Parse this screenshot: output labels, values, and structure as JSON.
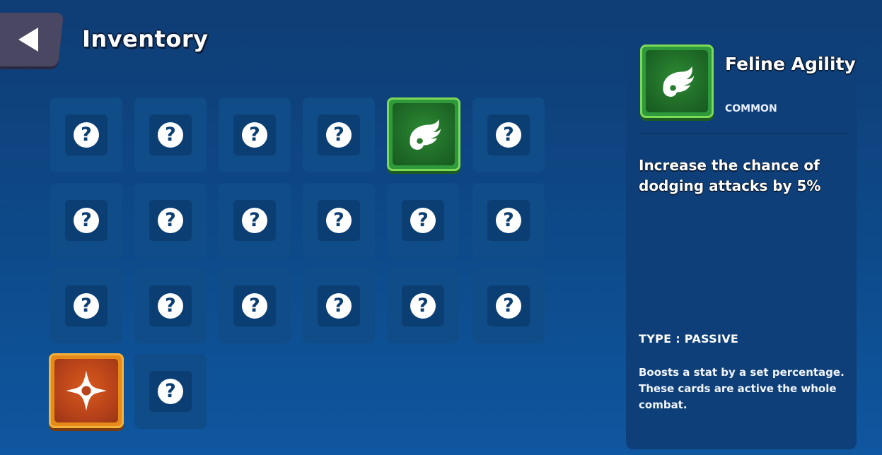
{
  "header": {
    "title": "Inventory",
    "back_icon": "back-arrow-icon"
  },
  "inventory": {
    "unknown_glyph": "?",
    "slots": [
      {
        "state": "locked"
      },
      {
        "state": "locked"
      },
      {
        "state": "locked"
      },
      {
        "state": "locked"
      },
      {
        "state": "card",
        "rarity": "common",
        "icon": "wing-icon"
      },
      {
        "state": "locked"
      },
      {
        "state": "locked"
      },
      {
        "state": "locked"
      },
      {
        "state": "locked"
      },
      {
        "state": "locked"
      },
      {
        "state": "locked"
      },
      {
        "state": "locked"
      },
      {
        "state": "locked"
      },
      {
        "state": "locked"
      },
      {
        "state": "locked"
      },
      {
        "state": "locked"
      },
      {
        "state": "locked"
      },
      {
        "state": "locked"
      },
      {
        "state": "card",
        "rarity": "epic",
        "icon": "shuriken-icon"
      },
      {
        "state": "locked"
      }
    ]
  },
  "detail": {
    "name": "Feline Agility",
    "rarity": "COMMON",
    "icon": "wing-icon",
    "description": "Increase the chance of dodging attacks by 5%",
    "type": "TYPE : PASSIVE",
    "type_description": "Boosts a stat by a set percentage. These cards are active the whole combat."
  },
  "colors": {
    "common_card": "#2f9a3b",
    "epic_card": "#e68a1c",
    "background": "#0d4a8a"
  }
}
